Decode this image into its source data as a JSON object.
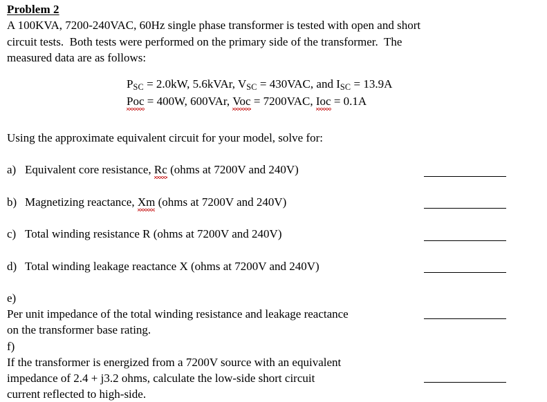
{
  "document": {
    "title": "Problem 2",
    "intro_lines": [
      "A 100KVA, 7200-240VAC, 60Hz single phase transformer is tested with open and short",
      "circuit tests.  Both tests were performed on the primary side of the transformer.  The",
      "measured data are as follows:"
    ],
    "given_data": {
      "short_circuit": {
        "p_symbol": "P",
        "p_subscript": "SC",
        "p_value": " = 2.0kW, 5.6kVAr, ",
        "v_symbol": "V",
        "v_subscript": "SC",
        "v_value": " = 430VAC, and ",
        "i_symbol": "I",
        "i_subscript": "SC",
        "i_value": " = 13.9A"
      },
      "open_circuit": {
        "p_symbol": "Poc",
        "p_value": " = 400W, 600VAr, ",
        "v_symbol": "Voc",
        "v_value": " = 7200VAC, ",
        "i_symbol": "Ioc",
        "i_value": " = 0.1A"
      }
    },
    "lead_in": "Using the approximate equivalent circuit for your model, solve for:",
    "items": [
      {
        "marker": "a)",
        "text_before": "Equivalent core resistance, ",
        "misspelled": "Rc",
        "text_after": " (ohms at 7200V and 240V)",
        "has_blank": true
      },
      {
        "marker": "b)",
        "text_before": "Magnetizing reactance, ",
        "misspelled": "Xm",
        "text_after": " (ohms at 7200V and 240V)",
        "has_blank": true
      },
      {
        "marker": "c)",
        "text_before": "Total winding resistance R (ohms at 7200V and 240V)",
        "misspelled": "",
        "text_after": "",
        "has_blank": true
      },
      {
        "marker": "d)",
        "text_before": "Total winding leakage reactance X (ohms at 7200V and 240V)",
        "misspelled": "",
        "text_after": "",
        "has_blank": true
      },
      {
        "marker": "e)",
        "lines": [
          "Per unit impedance of the total winding resistance and leakage reactance",
          "on the transformer base rating."
        ],
        "has_blank": true
      },
      {
        "marker": "f)",
        "lines": [
          "If the transformer is energized from a 7200V source with an equivalent",
          "impedance of 2.4 + j3.2 ohms, calculate the low-side short circuit",
          "current reflected to high-side."
        ],
        "has_blank": true
      }
    ]
  },
  "colors": {
    "text": "#000000",
    "background": "#ffffff",
    "spellcheck_underline": "#c00000"
  }
}
